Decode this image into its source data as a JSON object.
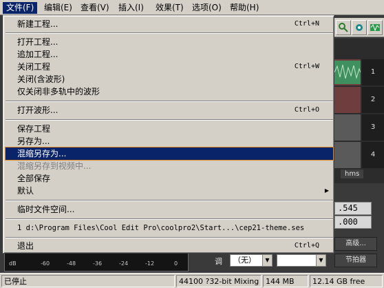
{
  "menubar": {
    "items": [
      "文件(F)",
      "编辑(E)",
      "查看(V)",
      "插入(I)",
      "效果(T)",
      "选项(O)",
      "帮助(H)"
    ]
  },
  "file_menu": {
    "items": [
      {
        "label": "新建工程...",
        "shortcut": "Ctrl+N"
      },
      {
        "label": "打开工程...",
        "shortcut": ""
      },
      {
        "label": "追加工程...",
        "shortcut": ""
      },
      {
        "label": "关闭工程",
        "shortcut": "Ctrl+W"
      },
      {
        "label": "关闭(含波形)",
        "shortcut": ""
      },
      {
        "label": "仅关闭非多轨中的波形",
        "shortcut": ""
      },
      {
        "label": "打开波形...",
        "shortcut": "Ctrl+O"
      },
      {
        "label": "保存工程",
        "shortcut": ""
      },
      {
        "label": "另存为...",
        "shortcut": ""
      },
      {
        "label": "混缩另存为...",
        "shortcut": ""
      },
      {
        "label": "混缩另存到视频中...",
        "shortcut": ""
      },
      {
        "label": "全部保存",
        "shortcut": ""
      },
      {
        "label": "默认",
        "shortcut": ""
      },
      {
        "label": "临时文件空间...",
        "shortcut": ""
      },
      {
        "label": "1 d:\\Program Files\\Cool Edit Pro\\coolpro2\\Start...\\cep21-theme.ses",
        "shortcut": ""
      },
      {
        "label": "退出",
        "shortcut": "Ctrl+Q"
      }
    ]
  },
  "tracks": {
    "numbers": [
      "1",
      "2",
      "3",
      "4"
    ],
    "time_unit": "hms"
  },
  "time_display": {
    "value_1": ".545",
    "value_2": ".000"
  },
  "level_meter": {
    "labels": [
      "dB",
      "-60",
      "-48",
      "-36",
      "-24",
      "-12",
      "0"
    ]
  },
  "transport": {
    "advanced_button": "高级...",
    "metronome_button": "节拍器",
    "tone_label": "调",
    "tone_value": "（无）"
  },
  "status_bar": {
    "state": "已停止",
    "format": "44100 ?32-bit Mixing",
    "memory": "144 MB",
    "disk_free": "12.14 GB free"
  },
  "colors": {
    "menu_highlight": "#0a246a",
    "focus_outline": "#e58a1a",
    "window_face": "#d4d0c8"
  }
}
